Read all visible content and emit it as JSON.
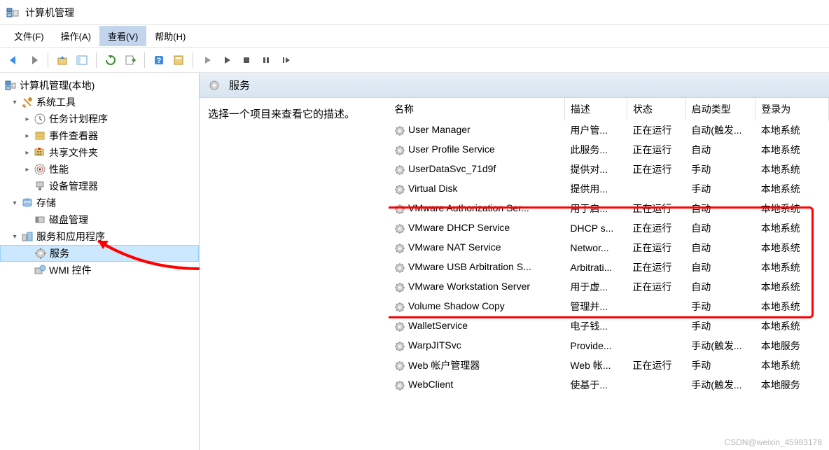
{
  "window": {
    "title": "计算机管理"
  },
  "menu": {
    "file": "文件(F)",
    "action": "操作(A)",
    "view": "查看(V)",
    "help": "帮助(H)"
  },
  "tree": {
    "root": "计算机管理(本地)",
    "system_tools": "系统工具",
    "task_scheduler": "任务计划程序",
    "event_viewer": "事件查看器",
    "shared_folders": "共享文件夹",
    "performance": "性能",
    "device_manager": "设备管理器",
    "storage": "存储",
    "disk_management": "磁盘管理",
    "services_apps": "服务和应用程序",
    "services": "服务",
    "wmi": "WMI 控件"
  },
  "panel": {
    "title": "服务",
    "hint": "选择一个项目来查看它的描述。"
  },
  "columns": {
    "name": "名称",
    "desc": "描述",
    "status": "状态",
    "start": "启动类型",
    "login": "登录为"
  },
  "services": [
    {
      "name": "User Manager",
      "desc": "用户管...",
      "status": "正在运行",
      "start": "自动(触发...",
      "login": "本地系统"
    },
    {
      "name": "User Profile Service",
      "desc": "此服务...",
      "status": "正在运行",
      "start": "自动",
      "login": "本地系统"
    },
    {
      "name": "UserDataSvc_71d9f",
      "desc": "提供对...",
      "status": "正在运行",
      "start": "手动",
      "login": "本地系统"
    },
    {
      "name": "Virtual Disk",
      "desc": "提供用...",
      "status": "",
      "start": "手动",
      "login": "本地系统"
    },
    {
      "name": "VMware Authorization Ser...",
      "desc": "用于启...",
      "status": "正在运行",
      "start": "自动",
      "login": "本地系统"
    },
    {
      "name": "VMware DHCP Service",
      "desc": "DHCP s...",
      "status": "正在运行",
      "start": "自动",
      "login": "本地系统"
    },
    {
      "name": "VMware NAT Service",
      "desc": "Networ...",
      "status": "正在运行",
      "start": "自动",
      "login": "本地系统"
    },
    {
      "name": "VMware USB Arbitration S...",
      "desc": "Arbitrati...",
      "status": "正在运行",
      "start": "自动",
      "login": "本地系统"
    },
    {
      "name": "VMware Workstation Server",
      "desc": "用于虚...",
      "status": "正在运行",
      "start": "自动",
      "login": "本地系统"
    },
    {
      "name": "Volume Shadow Copy",
      "desc": "管理并...",
      "status": "",
      "start": "手动",
      "login": "本地系统"
    },
    {
      "name": "WalletService",
      "desc": "电子钱...",
      "status": "",
      "start": "手动",
      "login": "本地系统"
    },
    {
      "name": "WarpJITSvc",
      "desc": "Provide...",
      "status": "",
      "start": "手动(触发...",
      "login": "本地服务"
    },
    {
      "name": "Web 帐户管理器",
      "desc": "Web 帐...",
      "status": "正在运行",
      "start": "手动",
      "login": "本地系统"
    },
    {
      "name": "WebClient",
      "desc": "使基于...",
      "status": "",
      "start": "手动(触发...",
      "login": "本地服务"
    }
  ],
  "watermark": "CSDN@weixin_45983178"
}
